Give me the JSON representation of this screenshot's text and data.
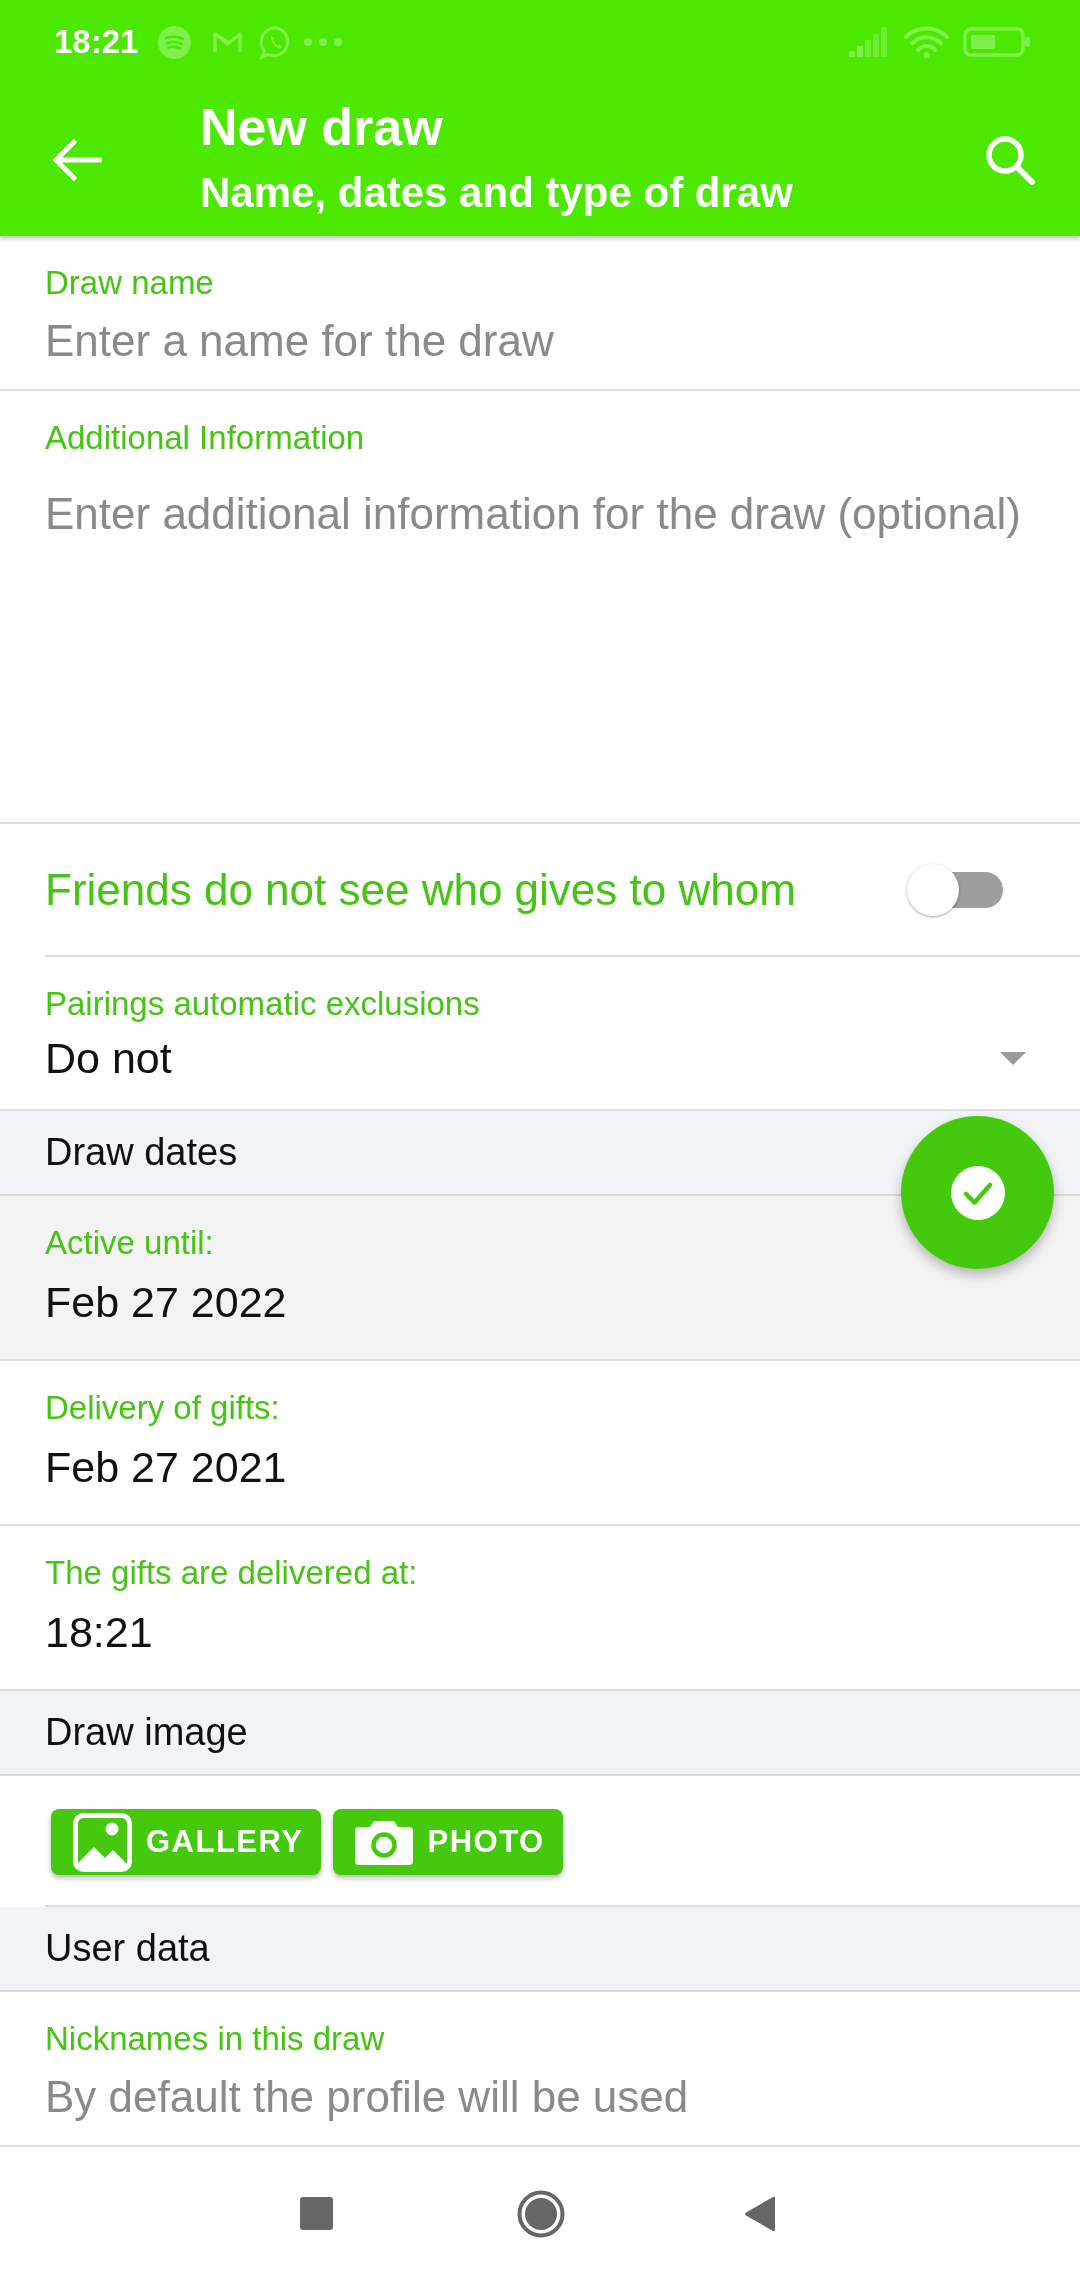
{
  "status_bar": {
    "time": "18:21"
  },
  "app_bar": {
    "title": "New draw",
    "subtitle": "Name, dates and type of draw"
  },
  "fields": [
    {
      "kind": "single",
      "label": "Draw name",
      "placeholder": "Enter a name for the draw"
    },
    {
      "kind": "multiline",
      "label": "Additional Information",
      "placeholder": "Enter additional information for the draw (optional)"
    }
  ],
  "privacy_switch": {
    "label": "Friends do not see who gives to whom",
    "on": false
  },
  "exclusions": {
    "label": "Pairings automatic exclusions",
    "value": "Do not"
  },
  "dates": {
    "title": "Draw dates",
    "items": [
      {
        "label": "Active until:",
        "value": "Feb 27 2022",
        "selected": true
      },
      {
        "label": "Delivery of gifts:",
        "value": "Feb 27 2021",
        "selected": false
      },
      {
        "label": "The gifts are delivered at:",
        "value": "18:21",
        "selected": false
      }
    ]
  },
  "image": {
    "title": "Draw image",
    "buttons": [
      {
        "kind": "gallery",
        "label": "GALLERY"
      },
      {
        "kind": "camera",
        "label": "PHOTO"
      }
    ]
  },
  "user_data": {
    "title": "User data",
    "field": {
      "label": "Nicknames in this draw",
      "placeholder": "By default the profile will be used"
    }
  }
}
